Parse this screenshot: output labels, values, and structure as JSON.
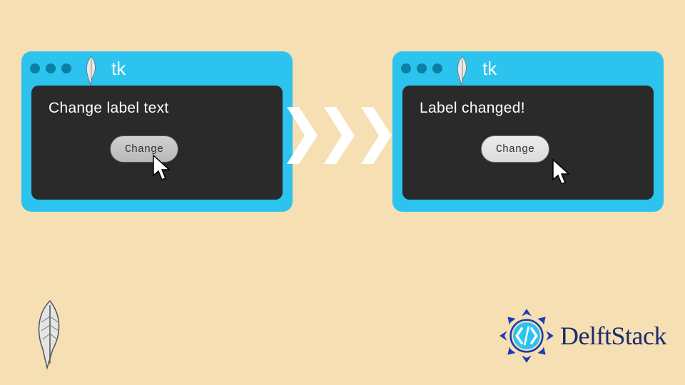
{
  "left_window": {
    "title": "tk",
    "label": "Change label text",
    "button": "Change"
  },
  "right_window": {
    "title": "tk",
    "label": "Label changed!",
    "button": "Change"
  },
  "brand": "DelftStack"
}
